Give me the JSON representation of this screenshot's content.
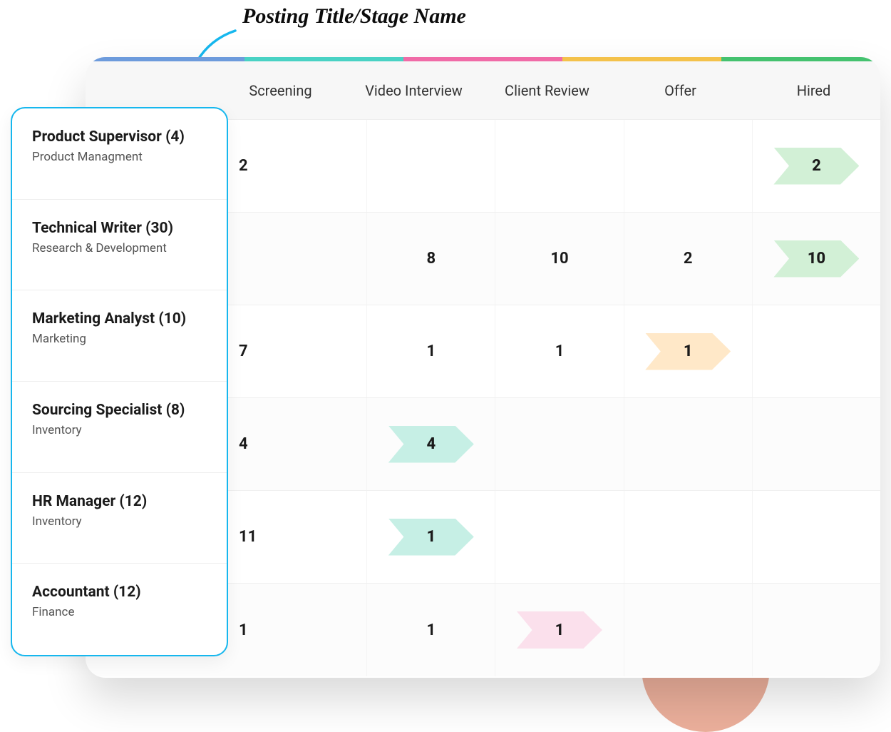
{
  "annotation": "Posting Title/Stage Name",
  "stage_colors": [
    "#6d9bdc",
    "#49d2c4",
    "#f06ba7",
    "#f4c24b",
    "#44c26f"
  ],
  "header": {
    "stages": [
      "Screening",
      "Video Interview",
      "Client Review",
      "Offer",
      "Hired"
    ]
  },
  "postings": [
    {
      "title": "Product Supervisor (4)",
      "dept": "Product Managment"
    },
    {
      "title": "Technical Writer (30)",
      "dept": "Research & Development"
    },
    {
      "title": "Marketing Analyst (10)",
      "dept": "Marketing"
    },
    {
      "title": "Sourcing Specialist (8)",
      "dept": "Inventory"
    },
    {
      "title": "HR Manager (12)",
      "dept": "Inventory"
    },
    {
      "title": "Accountant (12)",
      "dept": "Finance"
    }
  ],
  "rows": [
    [
      {
        "v": "2"
      },
      {
        "v": ""
      },
      {
        "v": ""
      },
      {
        "v": ""
      },
      {
        "v": "2",
        "chev": "green"
      }
    ],
    [
      {
        "v": ""
      },
      {
        "v": "8"
      },
      {
        "v": "10"
      },
      {
        "v": "2"
      },
      {
        "v": "10",
        "chev": "green"
      }
    ],
    [
      {
        "v": "7"
      },
      {
        "v": "1"
      },
      {
        "v": "1"
      },
      {
        "v": "1",
        "chev": "orange"
      },
      {
        "v": ""
      }
    ],
    [
      {
        "v": "4"
      },
      {
        "v": "4",
        "chev": "teal"
      },
      {
        "v": ""
      },
      {
        "v": ""
      },
      {
        "v": ""
      }
    ],
    [
      {
        "v": "11"
      },
      {
        "v": "1",
        "chev": "teal"
      },
      {
        "v": ""
      },
      {
        "v": ""
      },
      {
        "v": ""
      }
    ],
    [
      {
        "v": "1"
      },
      {
        "v": "1"
      },
      {
        "v": "1",
        "chev": "pink"
      },
      {
        "v": ""
      },
      {
        "v": ""
      }
    ]
  ]
}
